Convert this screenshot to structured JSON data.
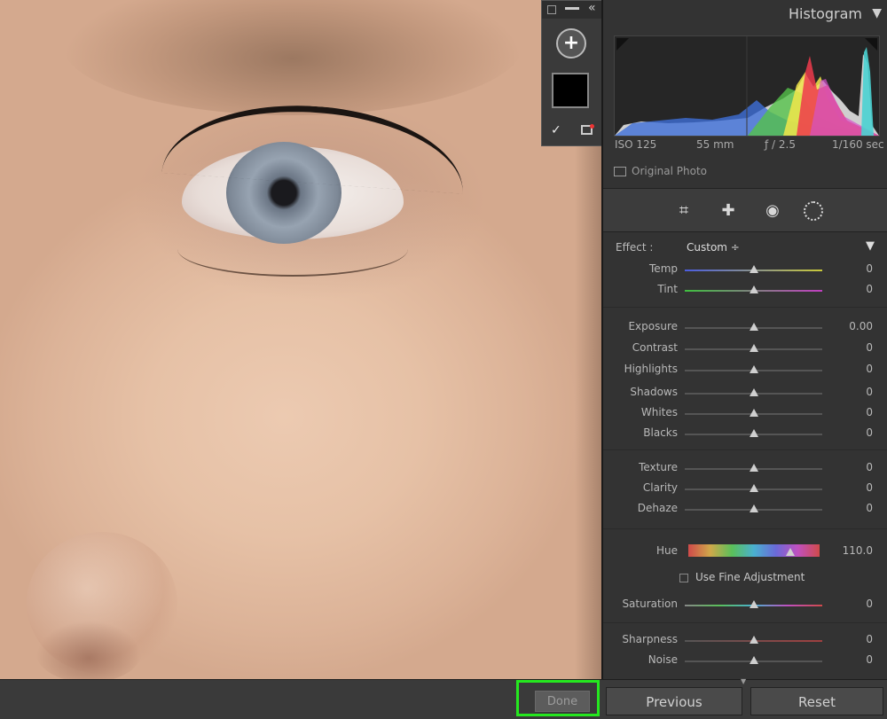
{
  "toolstrip": {
    "plus": "+",
    "check": "✓"
  },
  "histogram": {
    "title": "Histogram",
    "iso": "ISO 125",
    "focal": "55 mm",
    "aperture": "ƒ / 2.5",
    "shutter": "1/160 sec",
    "original_photo": "Original Photo"
  },
  "tools": [
    "crop-icon",
    "healing-icon",
    "red-eye-icon",
    "mask-icon"
  ],
  "effect": {
    "label": "Effect :",
    "value": "Custom ÷"
  },
  "sliders": {
    "temp": {
      "label": "Temp",
      "value": "0"
    },
    "tint": {
      "label": "Tint",
      "value": "0"
    },
    "exposure": {
      "label": "Exposure",
      "value": "0.00"
    },
    "contrast": {
      "label": "Contrast",
      "value": "0"
    },
    "highlights": {
      "label": "Highlights",
      "value": "0"
    },
    "shadows": {
      "label": "Shadows",
      "value": "0"
    },
    "whites": {
      "label": "Whites",
      "value": "0"
    },
    "blacks": {
      "label": "Blacks",
      "value": "0"
    },
    "texture": {
      "label": "Texture",
      "value": "0"
    },
    "clarity": {
      "label": "Clarity",
      "value": "0"
    },
    "dehaze": {
      "label": "Dehaze",
      "value": "0"
    },
    "hue": {
      "label": "Hue",
      "value": "110.0"
    },
    "saturation": {
      "label": "Saturation",
      "value": "0"
    },
    "sharpness": {
      "label": "Sharpness",
      "value": "0"
    },
    "noise": {
      "label": "Noise",
      "value": "0"
    }
  },
  "fine_adjustment": "Use Fine Adjustment",
  "buttons": {
    "done": "Done",
    "previous": "Previous",
    "reset": "Reset"
  },
  "colors": {
    "highlight_border": "#25e81f",
    "panel_bg": "#333333"
  }
}
